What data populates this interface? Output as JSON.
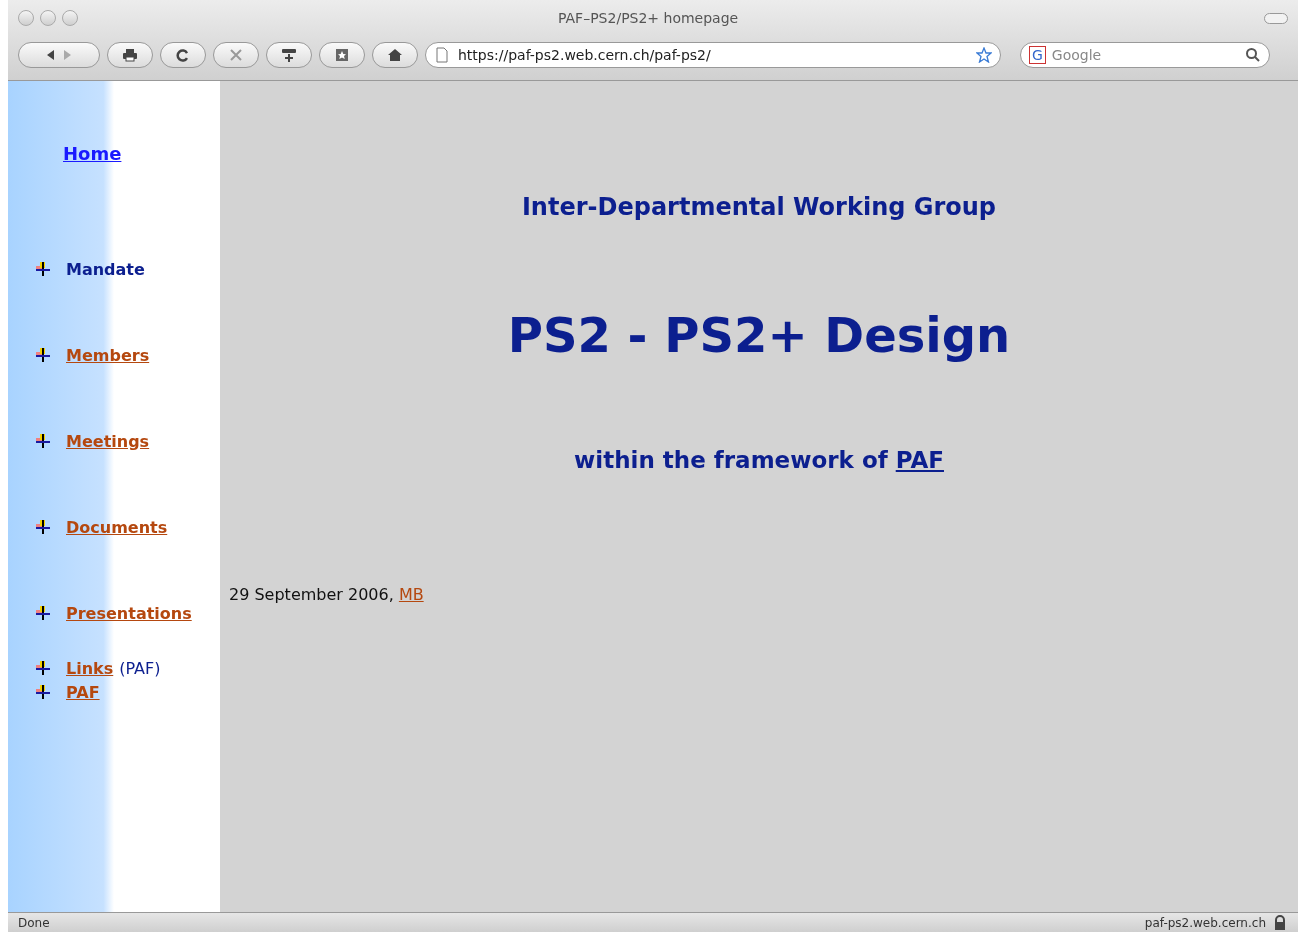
{
  "window": {
    "title": "PAF–PS2/PS2+ homepage"
  },
  "toolbar": {
    "url": "https://paf-ps2.web.cern.ch/paf-ps2/",
    "search_placeholder": "Google",
    "search_engine": "G"
  },
  "sidebar": {
    "home": "Home",
    "items": [
      {
        "label": "Mandate",
        "kind": "current",
        "group": false
      },
      {
        "label": "Members",
        "kind": "link",
        "group": false
      },
      {
        "label": "Meetings",
        "kind": "link",
        "group": false
      },
      {
        "label": "Documents",
        "kind": "link",
        "group": false
      },
      {
        "label": "Presentations",
        "kind": "link",
        "group": false
      },
      {
        "label": "Links",
        "kind": "link",
        "suffix": "(PAF)",
        "group": true
      },
      {
        "label": "PAF",
        "kind": "link",
        "group": true
      }
    ]
  },
  "main": {
    "subtitle": "Inter-Departmental Working Group",
    "title": "PS2 - PS2+ Design",
    "tagline": "within the framework of",
    "tagline_link": "PAF",
    "date": "29 September 2006,",
    "author": "MB"
  },
  "status_bar": {
    "status": "Done",
    "host": "paf-ps2.web.cern.ch"
  }
}
